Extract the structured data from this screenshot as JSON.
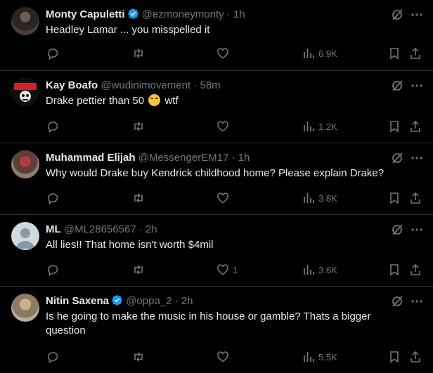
{
  "tweets": [
    {
      "display_name": "Monty Capuletti",
      "verified": true,
      "handle": "@ezmoneymonty",
      "separator": "·",
      "time": "1h",
      "text": "Headley Lamar ... you misspelled it",
      "replies": "",
      "retweets": "",
      "likes": "",
      "views": "6.9K"
    },
    {
      "display_name": "Kay Boafo",
      "verified": false,
      "handle": "@wudinimovement",
      "separator": "·",
      "time": "58m",
      "text_before_emoji": "Drake pettier than 50",
      "emoji": "grinning-squinting-face-emoji",
      "text_after_emoji": "wtf",
      "replies": "",
      "retweets": "",
      "likes": "",
      "views": "1.2K"
    },
    {
      "display_name": "Muhammad Elijah",
      "verified": false,
      "handle": "@MessengerEM17",
      "separator": "·",
      "time": "1h",
      "text": "Why would Drake buy Kendrick childhood home? Please explain Drake?",
      "replies": "",
      "retweets": "",
      "likes": "",
      "views": "3.8K"
    },
    {
      "display_name": "ML",
      "verified": false,
      "handle": "@ML28656567",
      "separator": "·",
      "time": "2h",
      "text": "All lies!! That home isn't worth $4mil",
      "replies": "",
      "retweets": "",
      "likes": "1",
      "views": "3.6K"
    },
    {
      "display_name": "Nitin Saxena",
      "verified": true,
      "handle": "@oppa_2",
      "separator": "·",
      "time": "2h",
      "text": "Is he going to make the music in his house or gamble? Thats a bigger question",
      "replies": "",
      "retweets": "",
      "likes": "",
      "views": "5.5K"
    }
  ],
  "icons": {
    "reply": "reply-icon",
    "retweet": "retweet-icon",
    "like": "heart-icon",
    "views": "views-chart-icon",
    "bookmark": "bookmark-icon",
    "share": "share-icon",
    "grok": "grok-icon",
    "more": "more-options-icon",
    "verified": "verified-badge-icon"
  },
  "colors": {
    "background": "#000000",
    "text": "#e7e9ea",
    "muted": "#71767b",
    "divider": "#2f3336",
    "verified": "#1d9bf0"
  }
}
